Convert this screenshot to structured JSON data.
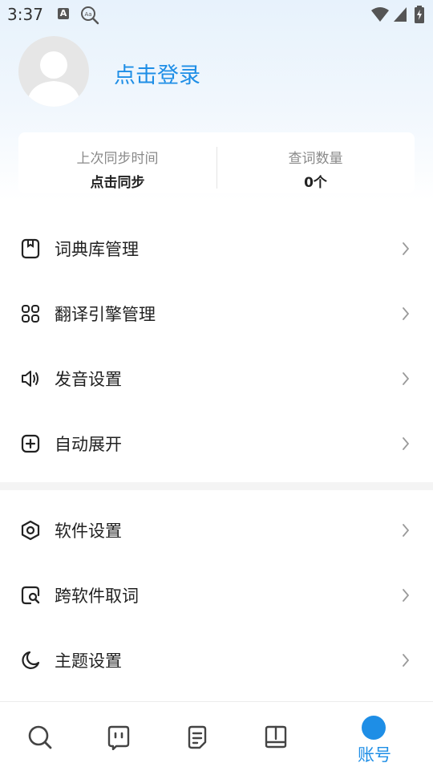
{
  "status_bar": {
    "time": "3:37",
    "a_badge": "A"
  },
  "profile": {
    "login_label": "点击登录"
  },
  "stats": {
    "last_sync_label": "上次同步时间",
    "last_sync_value": "点击同步",
    "word_count_label": "查词数量",
    "word_count_value": "0个"
  },
  "menu": {
    "items": [
      {
        "label": "词典库管理",
        "icon": "dictionary-icon"
      },
      {
        "label": "翻译引擎管理",
        "icon": "grid-icon"
      },
      {
        "label": "发音设置",
        "icon": "speaker-icon"
      },
      {
        "label": "自动展开",
        "icon": "plus-square-icon"
      },
      {
        "label": "软件设置",
        "icon": "hexagon-settings-icon"
      },
      {
        "label": "跨软件取词",
        "icon": "search-square-icon"
      },
      {
        "label": "主题设置",
        "icon": "moon-icon"
      }
    ]
  },
  "tab_bar": {
    "tabs": [
      {
        "name": "search",
        "icon": "search-icon"
      },
      {
        "name": "chat",
        "icon": "chat-icon"
      },
      {
        "name": "notes",
        "icon": "notes-icon"
      },
      {
        "name": "book",
        "icon": "book-icon"
      },
      {
        "name": "account",
        "icon": "account-icon",
        "label": "账号",
        "active": true
      }
    ]
  },
  "colors": {
    "accent": "#1e8ee6",
    "text": "#222222",
    "muted": "#8a8a8a",
    "chevron": "#9a9a9a"
  }
}
